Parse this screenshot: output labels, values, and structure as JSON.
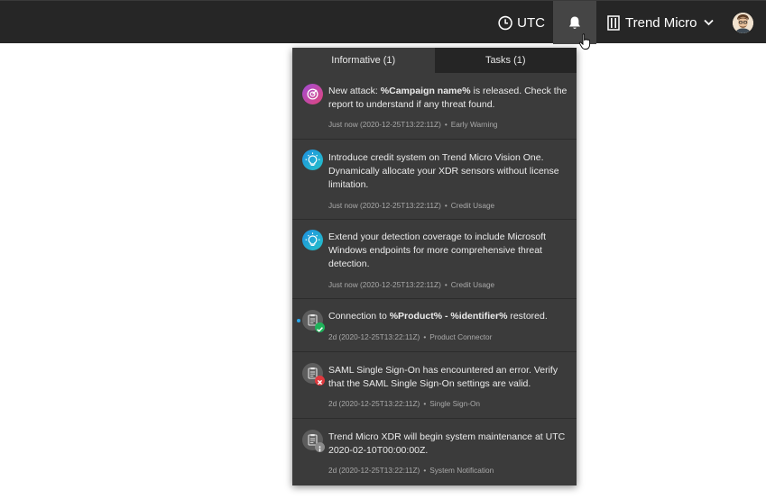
{
  "topbar": {
    "timezone_label": "UTC",
    "org_label": "Trend Micro"
  },
  "panel": {
    "tabs": [
      {
        "label": "Informative (1)",
        "active": true
      },
      {
        "label": "Tasks (1)",
        "active": false
      }
    ],
    "items": [
      {
        "icon": "target-icon",
        "msg_pre": "New attack: ",
        "msg_bold": "%Campaign name%",
        "msg_post": " is released. Check the report to understand if any threat found.",
        "time": "Just now (2020-12-25T13:22:11Z)",
        "category": "Early Warning"
      },
      {
        "icon": "lightbulb-icon",
        "msg": "Introduce credit system on Trend Micro Vision One. Dynamically allocate your XDR sensors without license limitation.",
        "time": "Just now (2020-12-25T13:22:11Z)",
        "category": "Credit Usage"
      },
      {
        "icon": "lightbulb-icon",
        "msg": "Extend your detection coverage to include Microsoft Windows endpoints for more comprehensive threat detection.",
        "time": "Just now (2020-12-25T13:22:11Z)",
        "category": "Credit Usage"
      },
      {
        "icon": "clipboard-success-icon",
        "msg_pre": "Connection to ",
        "msg_bold": "%Product% - %identifier%",
        "msg_post": " restored.",
        "time": "2d (2020-12-25T13:22:11Z)",
        "category": "Product Connector",
        "unread": true
      },
      {
        "icon": "clipboard-error-icon",
        "msg": "SAML Single Sign-On has encountered an error. Verify that the SAML Single Sign-On settings are valid.",
        "time": "2d (2020-12-25T13:22:11Z)",
        "category": "Single Sign-On"
      },
      {
        "icon": "clipboard-info-icon",
        "msg": "Trend Micro XDR will begin system maintenance at UTC 2020-02-10T00:00:00Z.",
        "time": "2d (2020-12-25T13:22:11Z)",
        "category": "System Notification"
      }
    ],
    "meta_separator": "•"
  },
  "colors": {
    "topbar_bg": "#262626",
    "panel_bg": "#3b3b3b",
    "tab_inactive_bg": "#252525",
    "success": "#1fb25a",
    "error": "#e0393e",
    "unread_dot": "#2aa8ee"
  }
}
